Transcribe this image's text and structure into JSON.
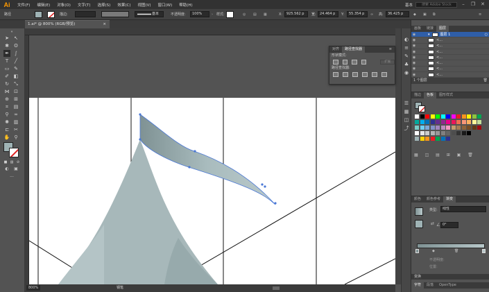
{
  "app": {
    "logo": "Ai"
  },
  "menu": [
    "文件(F)",
    "编辑(E)",
    "对象(O)",
    "文字(T)",
    "选择(S)",
    "效果(C)",
    "视图(V)",
    "窗口(W)",
    "帮助(H)"
  ],
  "menubar_right": {
    "workspace": "基本",
    "search_placeholder": "搜索 Adobe Stock"
  },
  "control_bar": {
    "selection_label": "路径",
    "stroke_label": "描边:",
    "stroke_profile": "基本",
    "opacity_label": "不透明度:",
    "opacity_value": "100%",
    "style_label": "样式:",
    "x_label": "X:",
    "x_value": "925.562 p",
    "w_label": "宽:",
    "w_value": "24.464 p",
    "y_label": "Y:",
    "y_value": "55.354 p",
    "h_label": "高:",
    "h_value": "36.425 p"
  },
  "document_tab": {
    "title": "1.ai* @ 800% (RGB/预览)",
    "close": "×"
  },
  "status_bar": {
    "zoom": "800%",
    "tool_name": "钢笔"
  },
  "pathfinder": {
    "tabs": [
      "对齐",
      "路径查找器"
    ],
    "shape_modes_label": "形状模式:",
    "pathfinders_label": "路径查找器:",
    "expand_label": "扩展"
  },
  "layers_panel": {
    "tabs": [
      "画板",
      "链接",
      "图层"
    ],
    "rows": [
      {
        "name": "图层 1",
        "selected": true
      },
      {
        "name": "<..."
      },
      {
        "name": "<..."
      },
      {
        "name": "<..."
      },
      {
        "name": "<..."
      },
      {
        "name": "<..."
      },
      {
        "name": "<..."
      },
      {
        "name": "<..."
      }
    ],
    "footer": "1 个图层"
  },
  "swatches_panel": {
    "tabs": [
      "描边",
      "色板",
      "图形样式"
    ]
  },
  "gradient_panel": {
    "tabs": [
      "颜色",
      "颜色参考",
      "渐变"
    ],
    "type_label": "类型:",
    "type_value": "线性",
    "angle_value": "0°",
    "opacity_label": "不透明度:",
    "position_label": "位置:"
  },
  "bottom_panels": {
    "transform_tab": "变换",
    "char_tabs": [
      "字符",
      "段落",
      "OpenType"
    ]
  },
  "colors": {
    "ui_dark": "#323232",
    "panel": "#535353",
    "shape_fill": "#9fb3b5",
    "selection_blue": "#4a78d6",
    "accent_orange": "#ff9a00"
  }
}
